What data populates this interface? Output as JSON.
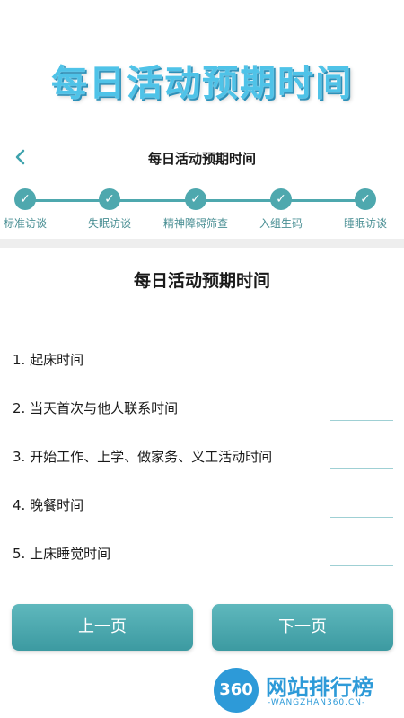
{
  "banner": "每日活动预期时间",
  "nav": {
    "back_icon": "chevron-left-icon",
    "title": "每日活动预期时间"
  },
  "steps": [
    {
      "label": "标准访谈"
    },
    {
      "label": "失眠访谈"
    },
    {
      "label": "精神障碍筛查"
    },
    {
      "label": "入组生码"
    },
    {
      "label": "睡眠访谈"
    }
  ],
  "form": {
    "title": "每日活动预期时间",
    "questions": [
      {
        "text": "1. 起床时间",
        "value": ""
      },
      {
        "text": "2. 当天首次与他人联系时间",
        "value": ""
      },
      {
        "text": "3. 开始工作、上学、做家务、义工活动时间",
        "value": ""
      },
      {
        "text": "4. 晚餐时间",
        "value": ""
      },
      {
        "text": "5. 上床睡觉时间",
        "value": ""
      }
    ]
  },
  "buttons": {
    "prev": "上一页",
    "next": "下一页"
  },
  "watermark": {
    "logo": "360",
    "text": "网站排行榜",
    "sub": "-WANGZHAN360.CN-"
  },
  "colors": {
    "accent": "#4ea8ae",
    "banner": "#4fc3e8",
    "watermark": "#2d9ad8"
  }
}
